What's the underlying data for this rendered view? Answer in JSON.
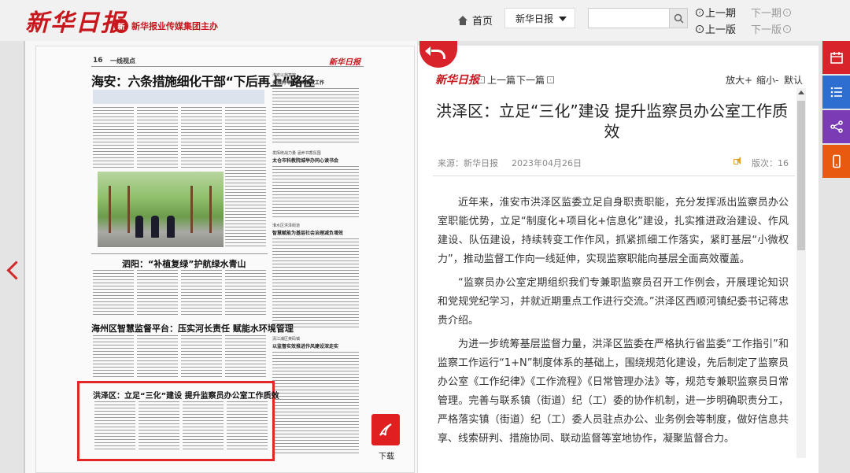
{
  "header": {
    "logo": "新华日报",
    "logo_sub": "新华报业传媒集团主办",
    "home_label": "首页",
    "paper_selected": "新华日报",
    "search_placeholder": "",
    "prev_issue": "上一期",
    "next_issue": "下一期",
    "prev_page": "上一版",
    "next_page": "下一版"
  },
  "newspaper": {
    "page_number": "16",
    "section": "一线视点",
    "brand": "新华日报",
    "headline_main": "海安：六条措施细化干部“下后再上”路径",
    "headline_2": "泗阳：“补植复绿”护航绿水青山",
    "headline_3": "海州区智慧监督平台：压实河长责任 赋能水环境管理",
    "headline_highlight": "洪泽区：立足“三化”建设 提升监察员办公室工作质效",
    "side_kicker_1": "淮安以档案馆",
    "side_head_1": "多措并举抓实风廉政工作",
    "side_kicker_2": "发挥统战力量 涵养书香氛围",
    "side_head_2": "太仓市科教院城举办同心读书会",
    "side_kicker_3": "淮水区洪泽街道",
    "side_head_3": "智慧赋能为基层社会治理减负增效",
    "side_kicker_4": "清江浦区黄码镇",
    "side_head_4": "以监督实效推进作风建设深走实",
    "download_label": "下载"
  },
  "article": {
    "brand": "新华日报",
    "prev_article": "上一篇",
    "next_article": "下一篇",
    "zoom_in": "放大+",
    "zoom_out": "缩小-",
    "default": "默认",
    "title": "洪泽区：立足“三化”建设 提升监察员办公室工作质效",
    "source": "来源：新华日报",
    "date": "2023年04月26日",
    "edition": "版次：16",
    "paragraphs": [
      "近年来，淮安市洪泽区监委立足自身职责职能，充分发挥派出监察员办公室职能优势，立足“制度化+项目化+信息化”建设，扎实推进政治建设、作风建设、队伍建设，持续转变工作作风，抓紧抓细工作落实，紧盯基层“小微权力”，推动监督工作向一线延伸，实现监察职能向基层全面高效覆盖。",
      "“监察员办公室定期组织我们专兼职监察员召开工作例会，开展理论知识和党规党纪学习，并就近期重点工作进行交流。”洪泽区西顺河镇纪委书记蒋忠贵介绍。",
      "为进一步统筹基层监督力量，洪泽区监委在严格执行省监委“工作指引”和监察工作运行“1+N”制度体系的基础上，围绕规范化建设，先后制定了监察员办公室《工作纪律》《工作流程》《日常管理办法》等，规范专兼职监察员日常管理。完善与联系镇（街道）纪（工）委的协作机制，进一步明确职责分工，严格落实镇（街道）纪（工）委人员驻点办公、业务例会等制度，做好信息共享、线索研判、措施协同、联动监督等室地协作，凝聚监督合力。"
    ]
  },
  "colors": {
    "brand_red": "#c8161d",
    "side_calendar": "#d8232a",
    "side_list": "#2e6ed1",
    "side_share": "#7a3bb5",
    "side_mobile": "#e85a10"
  }
}
